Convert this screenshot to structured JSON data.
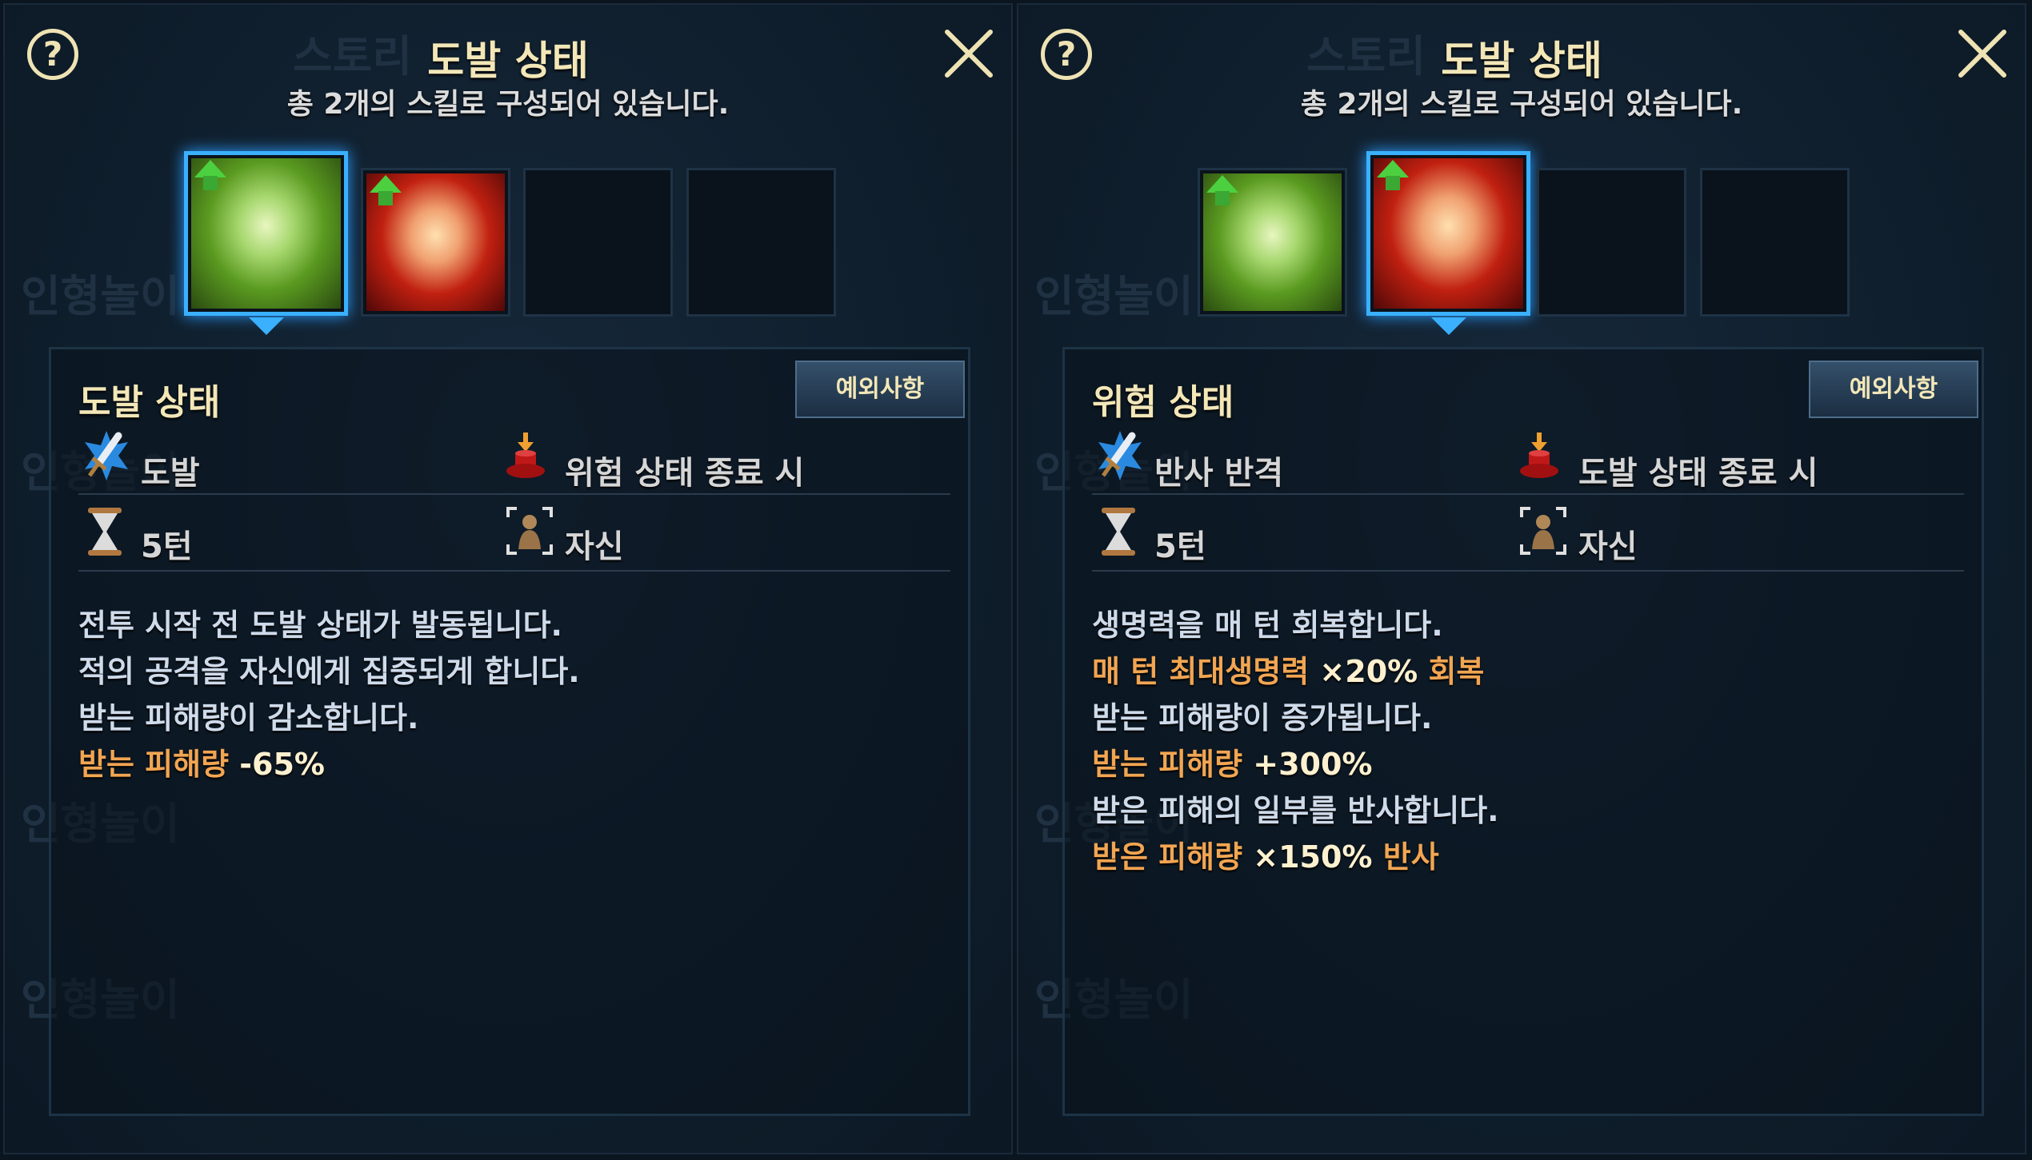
{
  "colors": {
    "title": "#f3e7b8",
    "text": "#cfdaea",
    "highlight": "#f2a552",
    "value": "#fff1cf",
    "selected_border": "#3ab0ff"
  },
  "background_labels": [
    "스토리",
    "인형놀이",
    "인형놀이",
    "인형놀이",
    "인형놀이"
  ],
  "panels": [
    {
      "title": "도발 상태",
      "subtitle": "총 2개의 스킬로 구성되어 있습니다.",
      "selected_card": 0,
      "cards": [
        {
          "type": "green",
          "upgrade": true
        },
        {
          "type": "red",
          "upgrade": true
        },
        {
          "type": "empty"
        },
        {
          "type": "empty"
        }
      ],
      "detail": {
        "name": "도발 상태",
        "exception_label": "예외사항",
        "skill_type_icon": "sword-icon",
        "skill_type": "도발",
        "trigger_icon": "trigger-icon",
        "trigger": "위험 상태 종료 시",
        "duration_icon": "hourglass-icon",
        "duration": "5턴",
        "target_icon": "target-person-icon",
        "target": "자신",
        "lines": [
          [
            {
              "t": "전투 시작 전 도발 상태가 발동됩니다.",
              "c": "text"
            }
          ],
          [
            {
              "t": "적의 공격을 자신에게 집중되게 합니다.",
              "c": "text"
            }
          ],
          [
            {
              "t": "받는 피해량이 감소합니다.",
              "c": "text"
            }
          ],
          [
            {
              "t": "받는 피해량 ",
              "c": "highlight"
            },
            {
              "t": "-65%",
              "c": "value"
            }
          ]
        ]
      }
    },
    {
      "title": "도발 상태",
      "subtitle": "총 2개의 스킬로 구성되어 있습니다.",
      "selected_card": 1,
      "cards": [
        {
          "type": "green",
          "upgrade": true
        },
        {
          "type": "red",
          "upgrade": true
        },
        {
          "type": "empty"
        },
        {
          "type": "empty"
        }
      ],
      "detail": {
        "name": "위험 상태",
        "exception_label": "예외사항",
        "skill_type_icon": "sword-icon",
        "skill_type": "반사 반격",
        "trigger_icon": "trigger-icon",
        "trigger": "도발 상태 종료 시",
        "duration_icon": "hourglass-icon",
        "duration": "5턴",
        "target_icon": "target-person-icon",
        "target": "자신",
        "lines": [
          [
            {
              "t": "생명력을 매 턴 회복합니다.",
              "c": "text"
            }
          ],
          [
            {
              "t": "매 턴 최대생명력 ",
              "c": "highlight"
            },
            {
              "t": "×20% ",
              "c": "value"
            },
            {
              "t": "회복",
              "c": "highlight"
            }
          ],
          [
            {
              "t": "받는 피해량이 증가됩니다.",
              "c": "text"
            }
          ],
          [
            {
              "t": "받는 피해량 ",
              "c": "highlight"
            },
            {
              "t": "+300%",
              "c": "value"
            }
          ],
          [
            {
              "t": "받은 피해의 일부를 반사합니다.",
              "c": "text"
            }
          ],
          [
            {
              "t": "받은 피해량 ",
              "c": "highlight"
            },
            {
              "t": "×150% ",
              "c": "value"
            },
            {
              "t": "반사",
              "c": "highlight"
            }
          ]
        ]
      }
    }
  ]
}
